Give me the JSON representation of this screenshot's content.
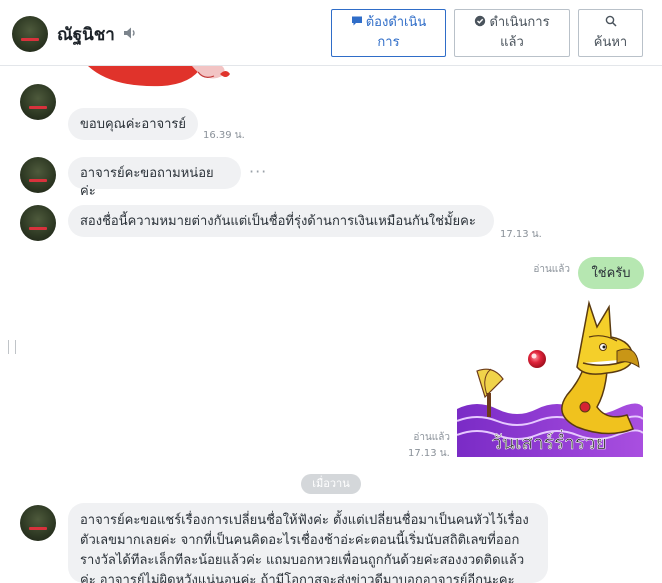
{
  "header": {
    "contact_name": "ณัฐนิชา",
    "btn_todo_line1": "ต้องดำเนิน",
    "btn_todo_line2": "การ",
    "btn_done_line1": "ดำเนินการ",
    "btn_done_line2": "แล้ว",
    "btn_search": "ค้นหา",
    "icons": {
      "speaker": "speaker-icon",
      "todo": "chat-bubble-icon",
      "done": "check-bubble-icon",
      "search": "search-icon"
    },
    "accent_color": "#2f6dc8"
  },
  "messages": [
    {
      "text": "ขอบคุณค่ะอาจารย์",
      "time": "16.39 น."
    },
    {
      "text": "อาจารย์คะขอถามหน่อยค่ะ",
      "more": "···"
    },
    {
      "text": "สองชื่อนี้ความหมายต่างกันแต่เป็นชื่อที่รุ่งด้านการเงินเหมือนกันใช่มั้ยคะ",
      "time": "17.13 น."
    },
    {
      "text": "ใช่ครับ",
      "read": "อ่านแล้ว",
      "sender": "me"
    },
    {
      "sticker_text": "วันเสาร์ร่ำรวย",
      "read": "อ่านแล้ว",
      "time": "17.13 น.",
      "sender": "me"
    }
  ],
  "date_separator": "เมื่อวาน",
  "last_message": {
    "lines": [
      "อาจารย์คะขอแชร์เรื่องการเปลี่ยนชื่อให้ฟังค่ะ ตั้งแต่เปลี่ยนชื่อมาเป็นคนหัวไว้เรื่อง",
      "ตัวเลขมากเลยค่ะ จากที่เป็นคนคิดอะไรเชื่องช้าอ่ะค่ะตอนนี้เริ่มนับสถิติเลขที่ออก",
      "รางวัลได้ทีละเล็กทีละน้อยแล้วค่ะ  แถมบอกหวยเพื่อนถูกกันด้วยค่ะสองงวดติดแล้ว",
      "ค่ะ อาจารย์ไม่ผิดหวังแน่นอนค่ะ ถ้ามีโอกาสจะส่งข่าวดีมาบอกอาจารย์อีกนะคะ"
    ]
  },
  "colors": {
    "my_bubble": "#b6e7b1",
    "their_bubble": "#f0f1f3"
  }
}
